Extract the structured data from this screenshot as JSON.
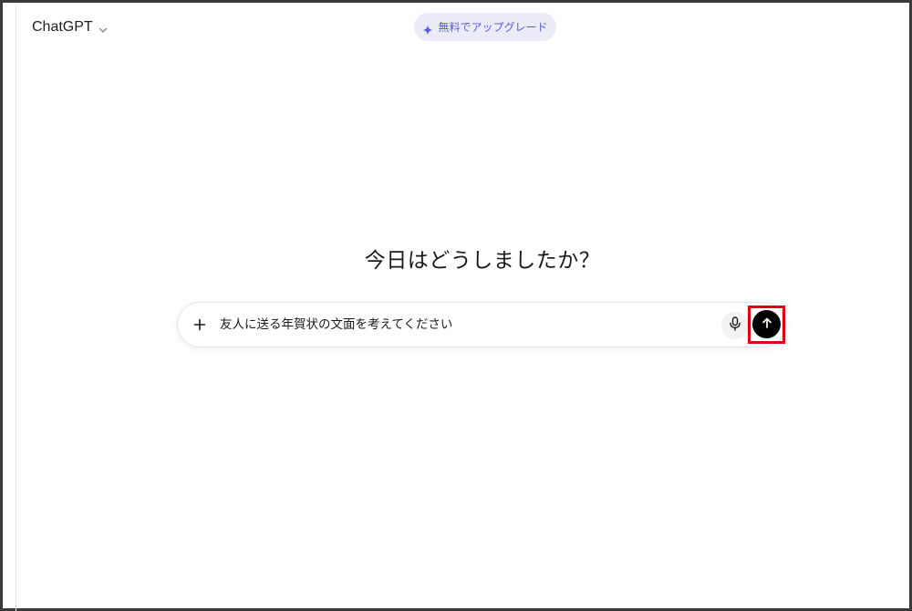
{
  "header": {
    "model_name": "ChatGPT",
    "model_chevron_icon": "chevron-down-icon",
    "upgrade_label": "無料でアップグレード",
    "upgrade_icon": "sparkle-icon",
    "accent_color": "#5a5ed6"
  },
  "main": {
    "greeting": "今日はどうしましたか？"
  },
  "composer": {
    "attach_icon": "plus-icon",
    "input_value": "友人に送る年賀状の文面を考えてください",
    "mic_icon": "microphone-icon",
    "send_icon": "arrow-up-icon",
    "highlight_color": "#e0001b"
  }
}
